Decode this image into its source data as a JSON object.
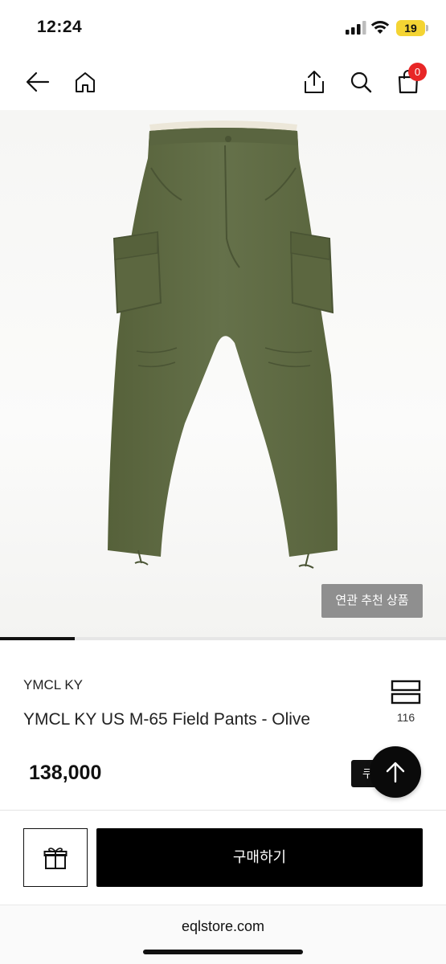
{
  "status_bar": {
    "time": "12:24",
    "battery": "19"
  },
  "nav": {
    "back_icon": "arrow-left-icon",
    "home_icon": "home-icon",
    "share_icon": "share-icon",
    "search_icon": "search-icon",
    "cart_icon": "shopping-bag-icon",
    "cart_count": "0"
  },
  "gallery": {
    "related_button": "연관 추천 상품",
    "progress": 0.167
  },
  "product": {
    "brand": "YMCL KY",
    "name": "YMCL KY US M-65 Field Pants - Olive",
    "price": "138,000",
    "like_count": "116",
    "coupon_label": "쿠"
  },
  "actions": {
    "gift_icon": "gift-icon",
    "buy_label": "구매하기",
    "top_icon": "arrow-up-icon"
  },
  "browser": {
    "url": "eqlstore.com"
  },
  "colors": {
    "accent": "#000000",
    "badge": "#e82626",
    "product": "#5f6a43"
  }
}
